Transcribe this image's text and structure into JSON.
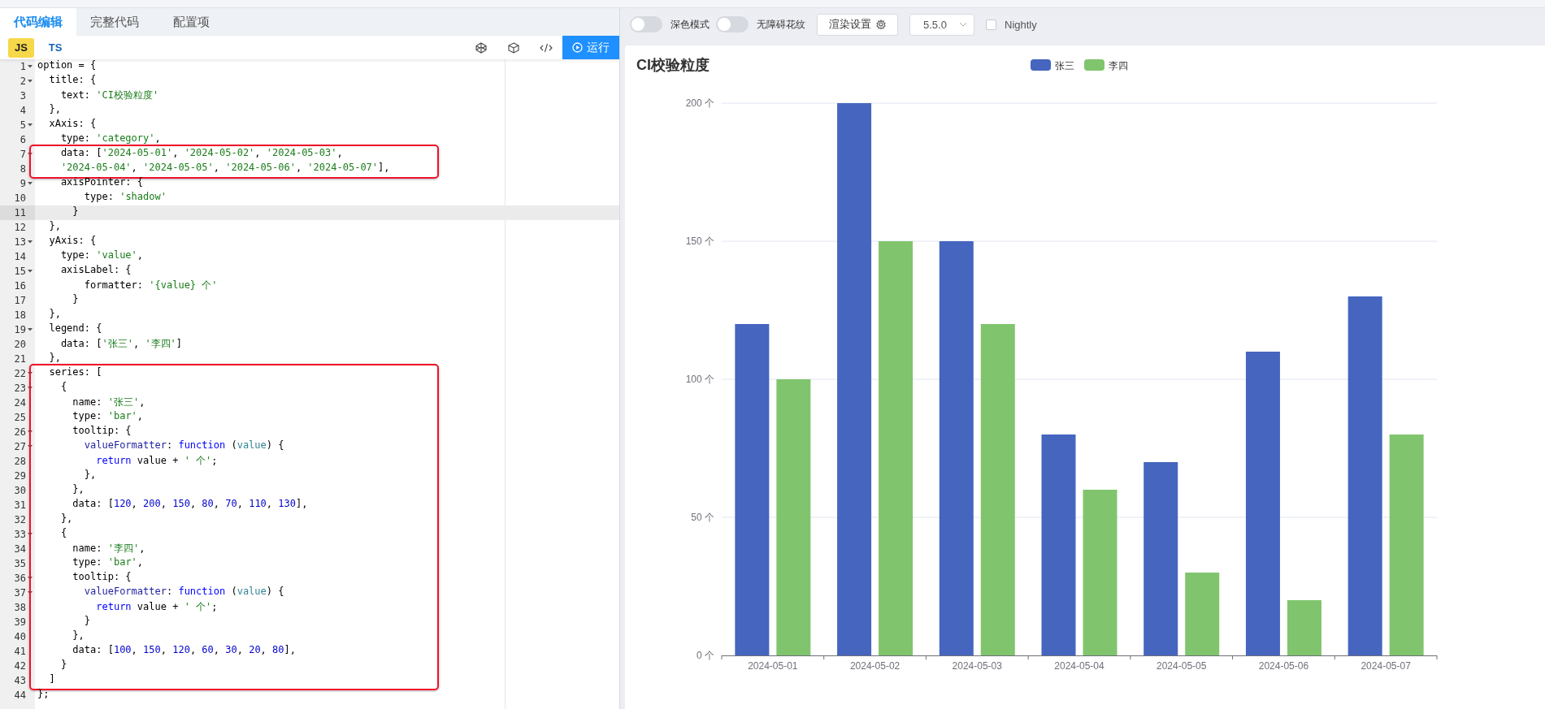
{
  "editor": {
    "tabs": [
      {
        "label": "代码编辑",
        "selected": true
      },
      {
        "label": "完整代码",
        "selected": false
      },
      {
        "label": "配置项",
        "selected": false
      }
    ],
    "language_tabs": [
      {
        "label": "JS",
        "selected": true
      },
      {
        "label": "TS",
        "selected": false
      }
    ],
    "run_button": "运行",
    "blocks": [
      {
        "boxed": false,
        "lines": [
          {
            "number": "1",
            "foldable": true,
            "active": false,
            "tokens": [
              {
                "kind": "plain",
                "text": "option = {"
              }
            ]
          },
          {
            "number": "2",
            "foldable": true,
            "active": false,
            "tokens": [
              {
                "kind": "plain",
                "text": "  title: {"
              }
            ]
          },
          {
            "number": "3",
            "foldable": false,
            "active": false,
            "tokens": [
              {
                "kind": "plain",
                "text": "    text: "
              },
              {
                "kind": "string",
                "text": "'CI校验粒度'"
              }
            ]
          },
          {
            "number": "4",
            "foldable": false,
            "active": false,
            "tokens": [
              {
                "kind": "plain",
                "text": "  },"
              }
            ]
          },
          {
            "number": "5",
            "foldable": true,
            "active": false,
            "tokens": [
              {
                "kind": "plain",
                "text": "  xAxis: {"
              }
            ]
          },
          {
            "number": "6",
            "foldable": false,
            "active": false,
            "tokens": [
              {
                "kind": "plain",
                "text": "    type: "
              },
              {
                "kind": "string",
                "text": "'category'"
              },
              {
                "kind": "plain",
                "text": ","
              }
            ]
          }
        ]
      },
      {
        "boxed": true,
        "lines": [
          {
            "number": "7",
            "foldable": true,
            "active": false,
            "tokens": [
              {
                "kind": "plain",
                "text": "    data: ["
              },
              {
                "kind": "string",
                "text": "'2024-05-01'"
              },
              {
                "kind": "plain",
                "text": ", "
              },
              {
                "kind": "string",
                "text": "'2024-05-02'"
              },
              {
                "kind": "plain",
                "text": ", "
              },
              {
                "kind": "string",
                "text": "'2024-05-03'"
              },
              {
                "kind": "plain",
                "text": ","
              }
            ]
          },
          {
            "number": "8",
            "foldable": false,
            "active": false,
            "tokens": [
              {
                "kind": "string",
                "text": "    '2024-05-04'"
              },
              {
                "kind": "plain",
                "text": ", "
              },
              {
                "kind": "string",
                "text": "'2024-05-05'"
              },
              {
                "kind": "plain",
                "text": ", "
              },
              {
                "kind": "string",
                "text": "'2024-05-06'"
              },
              {
                "kind": "plain",
                "text": ", "
              },
              {
                "kind": "string",
                "text": "'2024-05-07'"
              },
              {
                "kind": "plain",
                "text": "],"
              }
            ]
          }
        ]
      },
      {
        "boxed": false,
        "lines": [
          {
            "number": "9",
            "foldable": true,
            "active": false,
            "tokens": [
              {
                "kind": "plain",
                "text": "    axisPointer: {"
              }
            ]
          },
          {
            "number": "10",
            "foldable": false,
            "active": false,
            "tokens": [
              {
                "kind": "plain",
                "text": "        type: "
              },
              {
                "kind": "string",
                "text": "'shadow'"
              }
            ]
          },
          {
            "number": "11",
            "foldable": false,
            "active": true,
            "tokens": [
              {
                "kind": "plain",
                "text": "      }"
              }
            ]
          },
          {
            "number": "12",
            "foldable": false,
            "active": false,
            "tokens": [
              {
                "kind": "plain",
                "text": "  },"
              }
            ]
          },
          {
            "number": "13",
            "foldable": true,
            "active": false,
            "tokens": [
              {
                "kind": "plain",
                "text": "  yAxis: {"
              }
            ]
          },
          {
            "number": "14",
            "foldable": false,
            "active": false,
            "tokens": [
              {
                "kind": "plain",
                "text": "    type: "
              },
              {
                "kind": "string",
                "text": "'value'"
              },
              {
                "kind": "plain",
                "text": ","
              }
            ]
          },
          {
            "number": "15",
            "foldable": true,
            "active": false,
            "tokens": [
              {
                "kind": "plain",
                "text": "    axisLabel: {"
              }
            ]
          },
          {
            "number": "16",
            "foldable": false,
            "active": false,
            "tokens": [
              {
                "kind": "plain",
                "text": "        formatter: "
              },
              {
                "kind": "string",
                "text": "'{value} 个'"
              }
            ]
          },
          {
            "number": "17",
            "foldable": false,
            "active": false,
            "tokens": [
              {
                "kind": "plain",
                "text": "      }"
              }
            ]
          },
          {
            "number": "18",
            "foldable": false,
            "active": false,
            "tokens": [
              {
                "kind": "plain",
                "text": "  },"
              }
            ]
          },
          {
            "number": "19",
            "foldable": true,
            "active": false,
            "tokens": [
              {
                "kind": "plain",
                "text": "  legend: {"
              }
            ]
          },
          {
            "number": "20",
            "foldable": false,
            "active": false,
            "tokens": [
              {
                "kind": "plain",
                "text": "    data: ["
              },
              {
                "kind": "string",
                "text": "'张三'"
              },
              {
                "kind": "plain",
                "text": ", "
              },
              {
                "kind": "string",
                "text": "'李四'"
              },
              {
                "kind": "plain",
                "text": "]"
              }
            ]
          },
          {
            "number": "21",
            "foldable": false,
            "active": false,
            "tokens": [
              {
                "kind": "plain",
                "text": "  },"
              }
            ]
          }
        ]
      },
      {
        "boxed": true,
        "lines": [
          {
            "number": "22",
            "foldable": true,
            "active": false,
            "tokens": [
              {
                "kind": "plain",
                "text": "  series: ["
              }
            ]
          },
          {
            "number": "23",
            "foldable": true,
            "active": false,
            "tokens": [
              {
                "kind": "plain",
                "text": "    {"
              }
            ]
          },
          {
            "number": "24",
            "foldable": false,
            "active": false,
            "tokens": [
              {
                "kind": "plain",
                "text": "      name: "
              },
              {
                "kind": "string",
                "text": "'张三'"
              },
              {
                "kind": "plain",
                "text": ","
              }
            ]
          },
          {
            "number": "25",
            "foldable": false,
            "active": false,
            "tokens": [
              {
                "kind": "plain",
                "text": "      type: "
              },
              {
                "kind": "string",
                "text": "'bar'"
              },
              {
                "kind": "plain",
                "text": ","
              }
            ]
          },
          {
            "number": "26",
            "foldable": true,
            "active": false,
            "tokens": [
              {
                "kind": "plain",
                "text": "      tooltip: {"
              }
            ]
          },
          {
            "number": "27",
            "foldable": true,
            "active": false,
            "tokens": [
              {
                "kind": "property",
                "text": "        valueFormatter"
              },
              {
                "kind": "plain",
                "text": ": "
              },
              {
                "kind": "keyword",
                "text": "function"
              },
              {
                "kind": "plain",
                "text": " ("
              },
              {
                "kind": "param",
                "text": "value"
              },
              {
                "kind": "plain",
                "text": ") {"
              }
            ]
          },
          {
            "number": "28",
            "foldable": false,
            "active": false,
            "tokens": [
              {
                "kind": "keyword",
                "text": "          return"
              },
              {
                "kind": "plain",
                "text": " value + "
              },
              {
                "kind": "string",
                "text": "' 个'"
              },
              {
                "kind": "plain",
                "text": ";"
              }
            ]
          },
          {
            "number": "29",
            "foldable": false,
            "active": false,
            "tokens": [
              {
                "kind": "plain",
                "text": "        },"
              }
            ]
          },
          {
            "number": "30",
            "foldable": false,
            "active": false,
            "tokens": [
              {
                "kind": "plain",
                "text": "      },"
              }
            ]
          },
          {
            "number": "31",
            "foldable": false,
            "active": false,
            "tokens": [
              {
                "kind": "plain",
                "text": "      data: ["
              },
              {
                "kind": "number",
                "text": "120"
              },
              {
                "kind": "plain",
                "text": ", "
              },
              {
                "kind": "number",
                "text": "200"
              },
              {
                "kind": "plain",
                "text": ", "
              },
              {
                "kind": "number",
                "text": "150"
              },
              {
                "kind": "plain",
                "text": ", "
              },
              {
                "kind": "number",
                "text": "80"
              },
              {
                "kind": "plain",
                "text": ", "
              },
              {
                "kind": "number",
                "text": "70"
              },
              {
                "kind": "plain",
                "text": ", "
              },
              {
                "kind": "number",
                "text": "110"
              },
              {
                "kind": "plain",
                "text": ", "
              },
              {
                "kind": "number",
                "text": "130"
              },
              {
                "kind": "plain",
                "text": "],"
              }
            ]
          },
          {
            "number": "32",
            "foldable": false,
            "active": false,
            "tokens": [
              {
                "kind": "plain",
                "text": "    },"
              }
            ]
          },
          {
            "number": "33",
            "foldable": true,
            "active": false,
            "tokens": [
              {
                "kind": "plain",
                "text": "    {"
              }
            ]
          },
          {
            "number": "34",
            "foldable": false,
            "active": false,
            "tokens": [
              {
                "kind": "plain",
                "text": "      name: "
              },
              {
                "kind": "string",
                "text": "'李四'"
              },
              {
                "kind": "plain",
                "text": ","
              }
            ]
          },
          {
            "number": "35",
            "foldable": false,
            "active": false,
            "tokens": [
              {
                "kind": "plain",
                "text": "      type: "
              },
              {
                "kind": "string",
                "text": "'bar'"
              },
              {
                "kind": "plain",
                "text": ","
              }
            ]
          },
          {
            "number": "36",
            "foldable": true,
            "active": false,
            "tokens": [
              {
                "kind": "plain",
                "text": "      tooltip: {"
              }
            ]
          },
          {
            "number": "37",
            "foldable": true,
            "active": false,
            "tokens": [
              {
                "kind": "property",
                "text": "        valueFormatter"
              },
              {
                "kind": "plain",
                "text": ": "
              },
              {
                "kind": "keyword",
                "text": "function"
              },
              {
                "kind": "plain",
                "text": " ("
              },
              {
                "kind": "param",
                "text": "value"
              },
              {
                "kind": "plain",
                "text": ") {"
              }
            ]
          },
          {
            "number": "38",
            "foldable": false,
            "active": false,
            "tokens": [
              {
                "kind": "keyword",
                "text": "          return"
              },
              {
                "kind": "plain",
                "text": " value + "
              },
              {
                "kind": "string",
                "text": "' 个'"
              },
              {
                "kind": "plain",
                "text": ";"
              }
            ]
          },
          {
            "number": "39",
            "foldable": false,
            "active": false,
            "tokens": [
              {
                "kind": "plain",
                "text": "        }"
              }
            ]
          },
          {
            "number": "40",
            "foldable": false,
            "active": false,
            "tokens": [
              {
                "kind": "plain",
                "text": "      },"
              }
            ]
          },
          {
            "number": "41",
            "foldable": false,
            "active": false,
            "tokens": [
              {
                "kind": "plain",
                "text": "      data: ["
              },
              {
                "kind": "number",
                "text": "100"
              },
              {
                "kind": "plain",
                "text": ", "
              },
              {
                "kind": "number",
                "text": "150"
              },
              {
                "kind": "plain",
                "text": ", "
              },
              {
                "kind": "number",
                "text": "120"
              },
              {
                "kind": "plain",
                "text": ", "
              },
              {
                "kind": "number",
                "text": "60"
              },
              {
                "kind": "plain",
                "text": ", "
              },
              {
                "kind": "number",
                "text": "30"
              },
              {
                "kind": "plain",
                "text": ", "
              },
              {
                "kind": "number",
                "text": "20"
              },
              {
                "kind": "plain",
                "text": ", "
              },
              {
                "kind": "number",
                "text": "80"
              },
              {
                "kind": "plain",
                "text": "],"
              }
            ]
          },
          {
            "number": "42",
            "foldable": false,
            "active": false,
            "tokens": [
              {
                "kind": "plain",
                "text": "    }"
              }
            ]
          },
          {
            "number": "43",
            "foldable": false,
            "active": false,
            "tokens": [
              {
                "kind": "plain",
                "text": "  ]"
              }
            ]
          }
        ]
      },
      {
        "boxed": false,
        "lines": [
          {
            "number": "44",
            "foldable": false,
            "active": false,
            "tokens": [
              {
                "kind": "plain",
                "text": "};"
              }
            ]
          }
        ]
      }
    ]
  },
  "preview": {
    "toggles": [
      {
        "label": "深色模式",
        "on": false
      },
      {
        "label": "无障碍花纹",
        "on": false
      }
    ],
    "render_button": "渲染设置",
    "version_select": {
      "value": "5.5.0"
    },
    "nightly": {
      "label": "Nightly",
      "checked": false
    },
    "chart_data": {
      "type": "bar",
      "title": "CI校验粒度",
      "legend": true,
      "grid": true,
      "categories": [
        "2024-05-01",
        "2024-05-02",
        "2024-05-03",
        "2024-05-04",
        "2024-05-05",
        "2024-05-06",
        "2024-05-07"
      ],
      "series": [
        {
          "name": "张三",
          "color": "#4565bf",
          "values": [
            120,
            200,
            150,
            80,
            70,
            110,
            130
          ]
        },
        {
          "name": "李四",
          "color": "#80c56d",
          "values": [
            100,
            150,
            120,
            60,
            30,
            20,
            80
          ]
        }
      ],
      "ylim": [
        0,
        200
      ],
      "yticks": [
        {
          "value": 0,
          "label": "0 个"
        },
        {
          "value": 50,
          "label": "50 个"
        },
        {
          "value": 100,
          "label": "100 个"
        },
        {
          "value": 150,
          "label": "150 个"
        },
        {
          "value": 200,
          "label": "200 个"
        }
      ]
    }
  }
}
